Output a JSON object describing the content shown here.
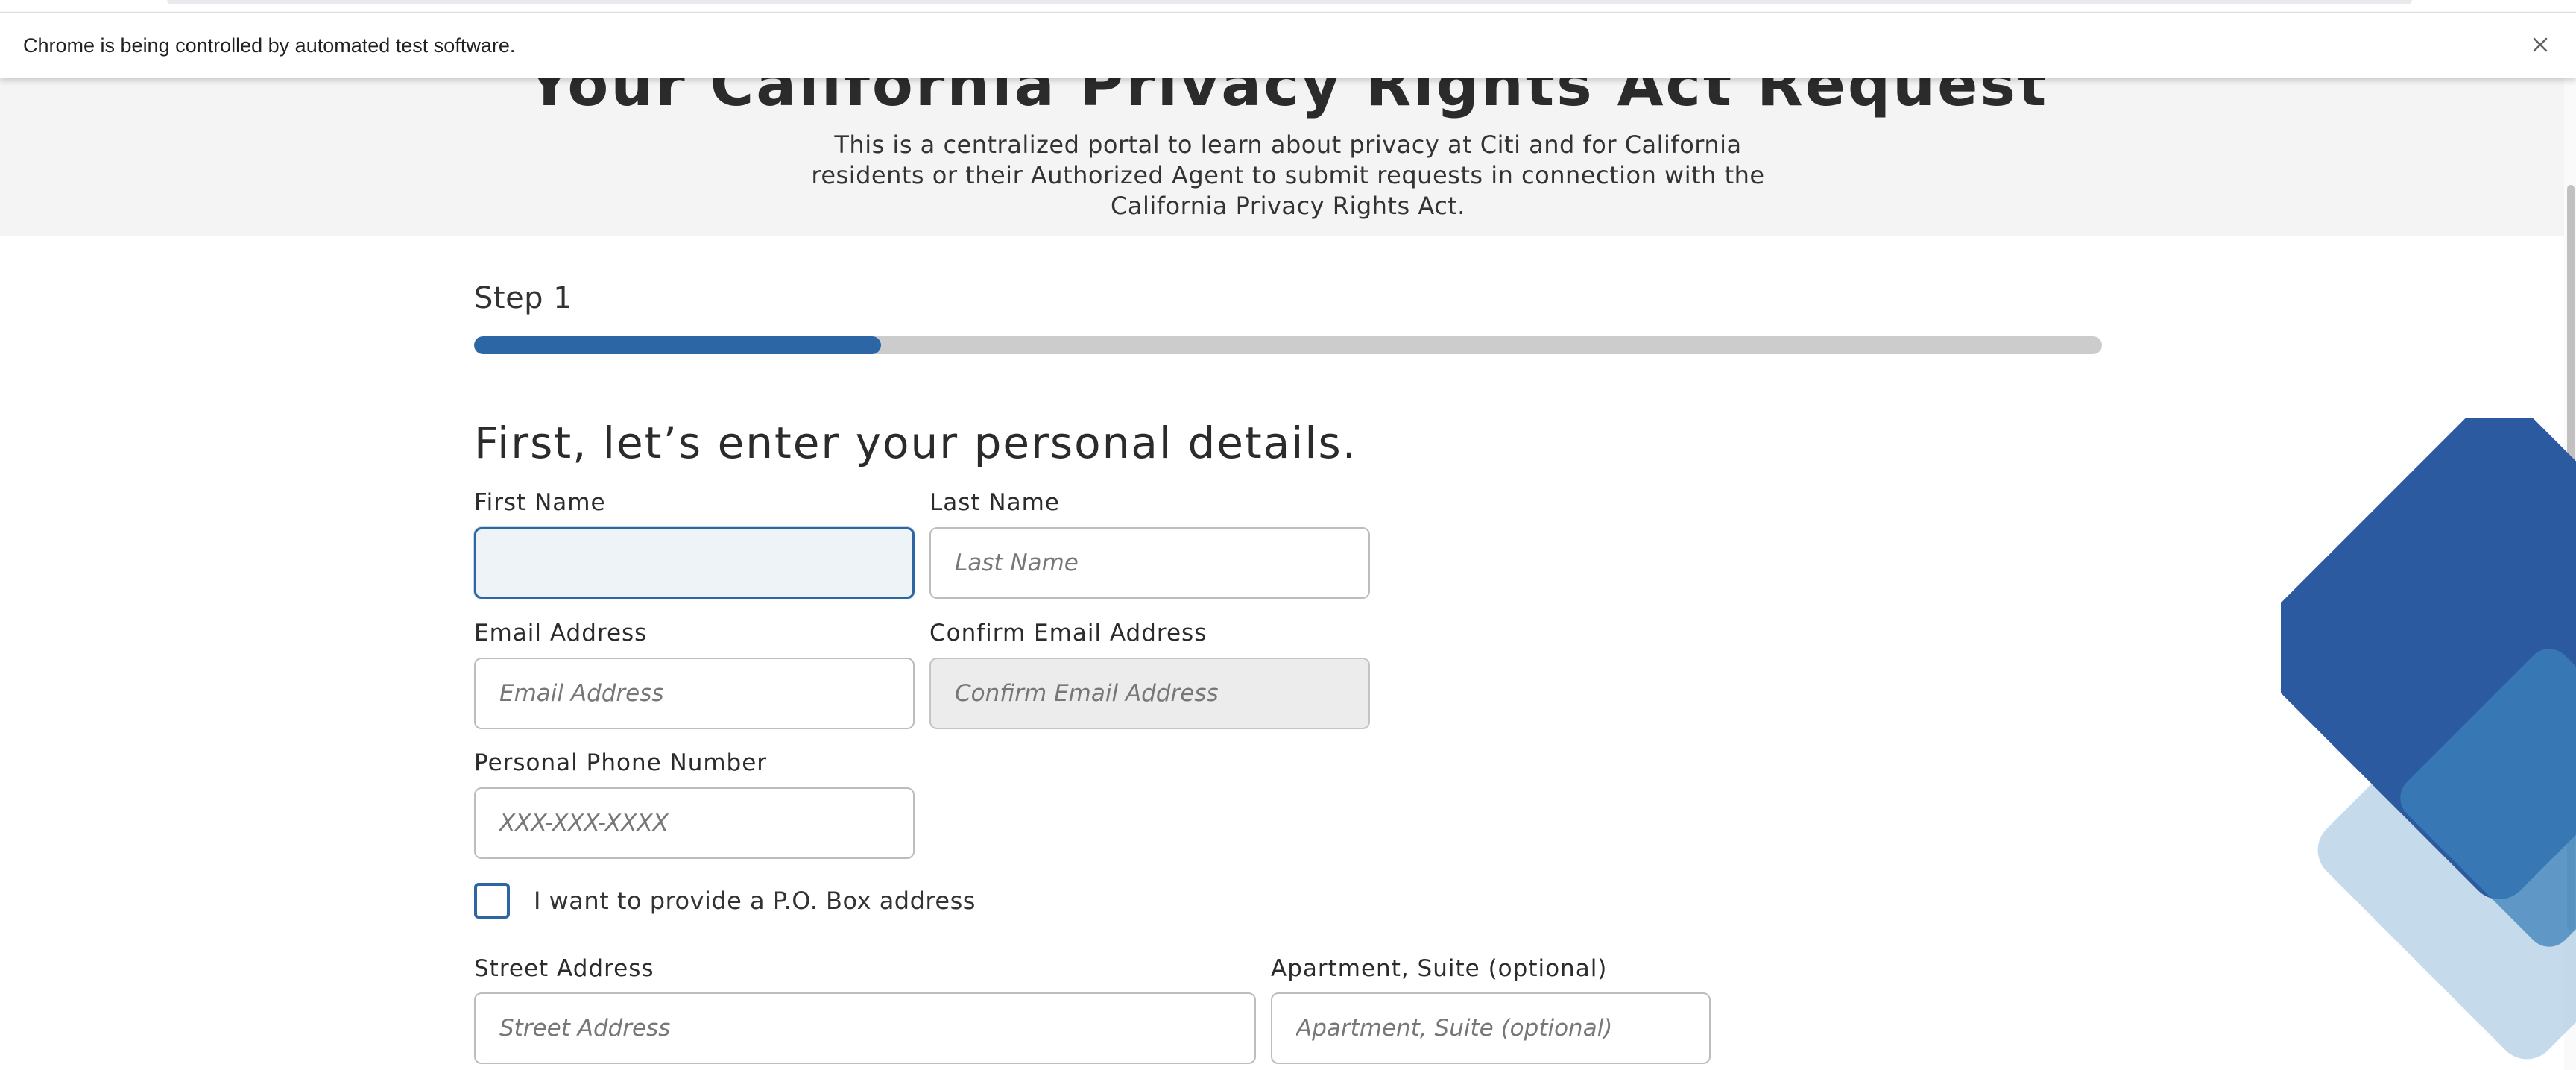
{
  "browser": {
    "infobar": {
      "message": "Chrome is being controlled by automated test software.",
      "close_icon": "close-icon"
    }
  },
  "hero": {
    "title": "Your California Privacy Rights Act Request",
    "description": "This is a centralized portal to learn about privacy at Citi and for California residents or their Authorized Agent to submit requests in connection with the California Privacy Rights Act."
  },
  "progress": {
    "step_label": "Step 1",
    "completion_fraction": 0.25,
    "fill_color": "#2c66a5",
    "track_color": "#cccccc"
  },
  "form": {
    "heading": "First, let’s enter your personal details.",
    "first_name": {
      "label": "First Name",
      "value": "",
      "placeholder": ""
    },
    "last_name": {
      "label": "Last Name",
      "value": "",
      "placeholder": "Last Name"
    },
    "email": {
      "label": "Email Address",
      "value": "",
      "placeholder": "Email Address"
    },
    "confirm_email": {
      "label": "Confirm Email Address",
      "value": "",
      "placeholder": "Confirm Email Address"
    },
    "phone": {
      "label": "Personal Phone Number",
      "value": "",
      "placeholder": "XXX-XXX-XXXX"
    },
    "po_box_checkbox": {
      "label": "I want to provide a P.O. Box address",
      "checked": false
    },
    "street": {
      "label": "Street Address",
      "value": "",
      "placeholder": "Street Address"
    },
    "apartment": {
      "label": "Apartment, Suite (optional)",
      "value": "",
      "placeholder": "Apartment, Suite (optional)"
    }
  },
  "colors": {
    "brand_blue": "#2b5aa0",
    "focus_blue": "#2c66a5",
    "hero_background": "#f4f4f4"
  }
}
